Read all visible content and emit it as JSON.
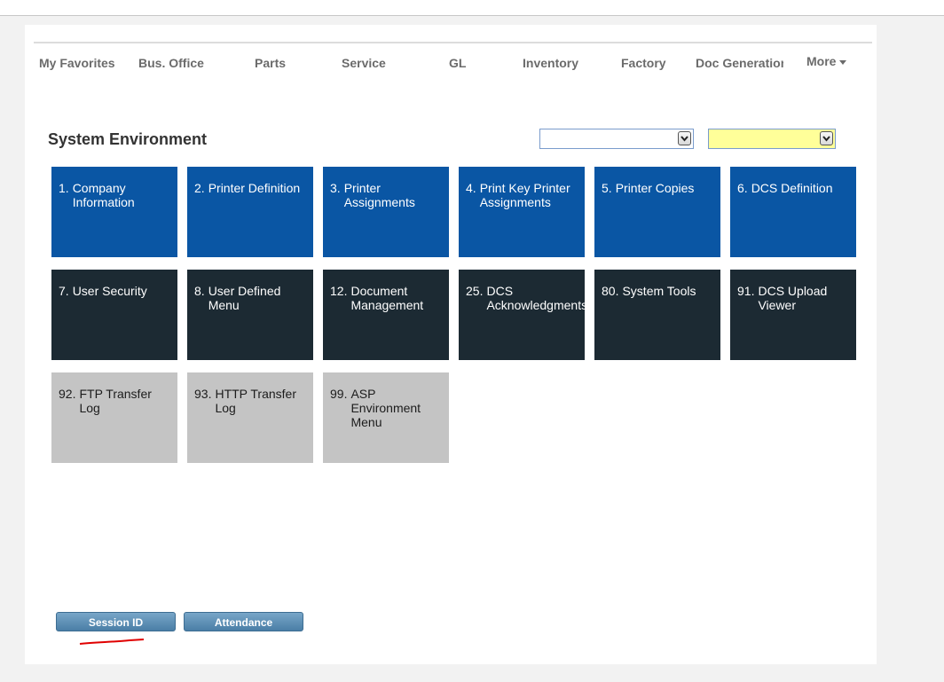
{
  "nav": {
    "items": [
      "My Favorites",
      "Bus. Office",
      "Parts",
      "Service",
      "GL",
      "Inventory",
      "Factory",
      "Doc Generation"
    ],
    "more_label": "More"
  },
  "page": {
    "title": "System Environment"
  },
  "selects": {
    "first": {
      "value": "",
      "color": "#ffffff"
    },
    "second": {
      "value": "",
      "color": "#ffff99"
    }
  },
  "tiles": [
    {
      "num": "1.",
      "label": "Company Information",
      "style": "blue"
    },
    {
      "num": "2.",
      "label": "Printer Definition",
      "style": "blue"
    },
    {
      "num": "3.",
      "label": "Printer Assignments",
      "style": "blue"
    },
    {
      "num": "4.",
      "label": "Print Key Printer Assignments",
      "style": "blue"
    },
    {
      "num": "5.",
      "label": "Printer Copies",
      "style": "blue"
    },
    {
      "num": "6.",
      "label": "DCS Definition",
      "style": "blue"
    },
    {
      "num": "7.",
      "label": "User Security",
      "style": "dark"
    },
    {
      "num": "8.",
      "label": "User Defined Menu",
      "style": "dark"
    },
    {
      "num": "12.",
      "label": "Document Management",
      "style": "dark"
    },
    {
      "num": "25.",
      "label": "DCS Acknowledgments",
      "style": "dark"
    },
    {
      "num": "80.",
      "label": "System Tools",
      "style": "dark"
    },
    {
      "num": "91.",
      "label": "DCS Upload Viewer",
      "style": "dark"
    },
    {
      "num": "92.",
      "label": "FTP Transfer Log",
      "style": "grey"
    },
    {
      "num": "93.",
      "label": "HTTP Transfer Log",
      "style": "grey"
    },
    {
      "num": "99.",
      "label": "ASP Environment Menu",
      "style": "grey"
    }
  ],
  "buttons": {
    "session_id": "Session ID",
    "attendance": "Attendance"
  },
  "colors": {
    "blue_tile": "#0a56a4",
    "dark_tile": "#1c2a33",
    "grey_tile": "#c4c4c4",
    "annotation": "#e00000"
  }
}
